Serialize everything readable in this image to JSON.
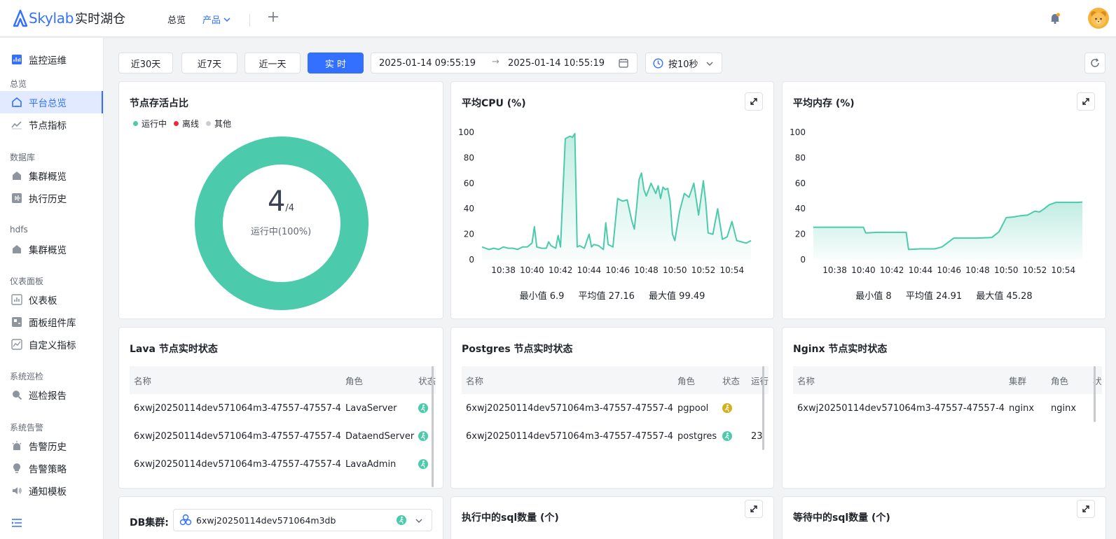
{
  "header": {
    "brand": "Skylab",
    "brand_sub": "实时湖仓",
    "nav_overview": "总览",
    "nav_product": "产品"
  },
  "sidebar": {
    "top_item": "监控运维",
    "groups": [
      {
        "label": "总览",
        "items": [
          "平台总览",
          "节点指标"
        ]
      },
      {
        "label": "数据库",
        "items": [
          "集群概览",
          "执行历史"
        ]
      },
      {
        "label": "hdfs",
        "items": [
          "集群概览"
        ]
      },
      {
        "label": "仪表面板",
        "items": [
          "仪表板",
          "面板组件库",
          "自定义指标"
        ]
      },
      {
        "label": "系统巡检",
        "items": [
          "巡检报告"
        ]
      },
      {
        "label": "系统告警",
        "items": [
          "告警历史",
          "告警策略",
          "通知模板"
        ]
      }
    ],
    "active_item": "平台总览"
  },
  "toolbar": {
    "range_30d": "近30天",
    "range_7d": "近7天",
    "range_1d": "近一天",
    "range_realtime": "实 时",
    "start_time": "2025-01-14 09:55:19",
    "end_time": "2025-01-14 10:55:19",
    "interval": "按10秒"
  },
  "node_ratio": {
    "title": "节点存活占比",
    "legend": [
      "运行中",
      "离线",
      "其他"
    ],
    "running": "4",
    "total": "/4",
    "running_label": "运行中(100%)",
    "colors": {
      "running": "#4ccbac",
      "offline": "#f0263c",
      "other": "#c9cdd4"
    }
  },
  "cpu_card": {
    "title": "平均CPU (%)",
    "min_label": "最小值 6.9",
    "avg_label": "平均值 27.16",
    "max_label": "最大值 99.49"
  },
  "mem_card": {
    "title": "平均内存 (%)",
    "min_label": "最小值 8",
    "avg_label": "平均值 24.91",
    "max_label": "最大值 45.28"
  },
  "chart_data": [
    {
      "type": "area",
      "title": "平均CPU (%)",
      "x_ticks": [
        "10:38",
        "10:40",
        "10:42",
        "10:44",
        "10:46",
        "10:48",
        "10:50",
        "10:52",
        "10:54"
      ],
      "ylim": [
        0,
        100
      ],
      "y_ticks": [
        0,
        20,
        40,
        60,
        80,
        100
      ],
      "x": [
        "10:36:30",
        "10:37:00",
        "10:37:20",
        "10:37:40",
        "10:38:00",
        "10:38:20",
        "10:38:40",
        "10:39:00",
        "10:39:20",
        "10:39:40",
        "10:40:00",
        "10:40:10",
        "10:40:20",
        "10:40:40",
        "10:41:00",
        "10:41:10",
        "10:41:20",
        "10:41:40",
        "10:41:50",
        "10:42:00",
        "10:42:20",
        "10:42:40",
        "10:42:50",
        "10:43:00",
        "10:43:10",
        "10:43:20",
        "10:43:40",
        "10:44:00",
        "10:44:10",
        "10:44:20",
        "10:44:40",
        "10:45:00",
        "10:45:10",
        "10:45:20",
        "10:45:40",
        "10:46:00",
        "10:46:20",
        "10:46:40",
        "10:47:00",
        "10:47:10",
        "10:47:20",
        "10:47:30",
        "10:47:40",
        "10:47:50",
        "10:48:00",
        "10:48:20",
        "10:48:40",
        "10:48:50",
        "10:49:00",
        "10:49:10",
        "10:49:20",
        "10:49:30",
        "10:49:40",
        "10:49:50",
        "10:50:00",
        "10:50:20",
        "10:50:40",
        "10:51:00",
        "10:51:20",
        "10:51:40",
        "10:52:00",
        "10:52:10",
        "10:52:20",
        "10:52:40",
        "10:53:00",
        "10:53:20",
        "10:53:40",
        "10:54:00",
        "10:54:20",
        "10:54:40",
        "10:55:00",
        "10:55:20"
      ],
      "values": [
        10,
        8,
        9,
        8,
        10,
        9,
        9,
        8,
        10,
        10,
        13,
        26,
        10,
        9,
        9,
        14,
        11,
        9,
        19,
        10,
        95,
        97,
        96,
        99,
        10,
        11,
        9,
        20,
        10,
        12,
        11,
        8,
        29,
        12,
        10,
        48,
        46,
        47,
        30,
        24,
        42,
        63,
        68,
        55,
        50,
        60,
        52,
        58,
        48,
        57,
        55,
        56,
        46,
        20,
        15,
        38,
        52,
        49,
        60,
        35,
        62,
        45,
        21,
        20,
        40,
        16,
        18,
        30,
        15,
        14,
        13,
        15
      ]
    },
    {
      "type": "area",
      "title": "平均内存 (%)",
      "x_ticks": [
        "10:38",
        "10:40",
        "10:42",
        "10:44",
        "10:46",
        "10:48",
        "10:50",
        "10:52",
        "10:54"
      ],
      "ylim": [
        0,
        100
      ],
      "y_ticks": [
        0,
        20,
        40,
        60,
        80,
        100
      ],
      "x": [
        "10:36:30",
        "10:40:00",
        "10:40:10",
        "10:41:00",
        "10:42:00",
        "10:43:00",
        "10:43:10",
        "10:44:00",
        "10:45:00",
        "10:45:30",
        "10:46:20",
        "10:47:00",
        "10:48:00",
        "10:49:00",
        "10:49:30",
        "10:50:00",
        "10:50:30",
        "10:51:00",
        "10:51:30",
        "10:52:00",
        "10:52:20",
        "10:52:40",
        "10:53:00",
        "10:53:30",
        "10:54:00",
        "10:55:00",
        "10:55:20"
      ],
      "values": [
        25.5,
        25.5,
        21,
        21.5,
        21.5,
        21.5,
        8,
        8.5,
        8.5,
        10,
        17,
        17,
        17,
        17.5,
        22,
        33,
        33.5,
        34.5,
        35,
        38,
        37.5,
        40,
        43,
        45,
        45,
        45,
        45.28
      ]
    }
  ],
  "lava_table": {
    "title": "Lava 节点实时状态",
    "columns": [
      "名称",
      "角色",
      "状态"
    ],
    "rows": [
      {
        "name": "6xwj20250114dev571064m3-47557-47557-4",
        "role": "LavaServer"
      },
      {
        "name": "6xwj20250114dev571064m3-47557-47557-4",
        "role": "DataendServer"
      },
      {
        "name": "6xwj20250114dev571064m3-47557-47557-4",
        "role": "LavaAdmin"
      }
    ]
  },
  "pg_table": {
    "title": "Postgres 节点实时状态",
    "columns": [
      "名称",
      "角色",
      "状态",
      "运行"
    ],
    "rows": [
      {
        "name": "6xwj20250114dev571064m3-47557-47557-4",
        "role": "pgpool",
        "runtime": ""
      },
      {
        "name": "6xwj20250114dev571064m3-47557-47557-4",
        "role": "postgres",
        "runtime": "23"
      }
    ]
  },
  "nginx_table": {
    "title": "Nginx 节点实时状态",
    "columns": [
      "名称",
      "集群",
      "角色",
      "状"
    ],
    "rows": [
      {
        "name": "6xwj20250114dev571064m3-47557-47557-4",
        "cluster": "nginx",
        "role": "nginx"
      }
    ]
  },
  "db_cluster": {
    "label": "DB集群:",
    "selected": "6xwj20250114dev571064m3db"
  },
  "sql_running": {
    "title": "执行中的sql数量 (个)"
  },
  "sql_waiting": {
    "title": "等待中的sql数量 (个)"
  }
}
